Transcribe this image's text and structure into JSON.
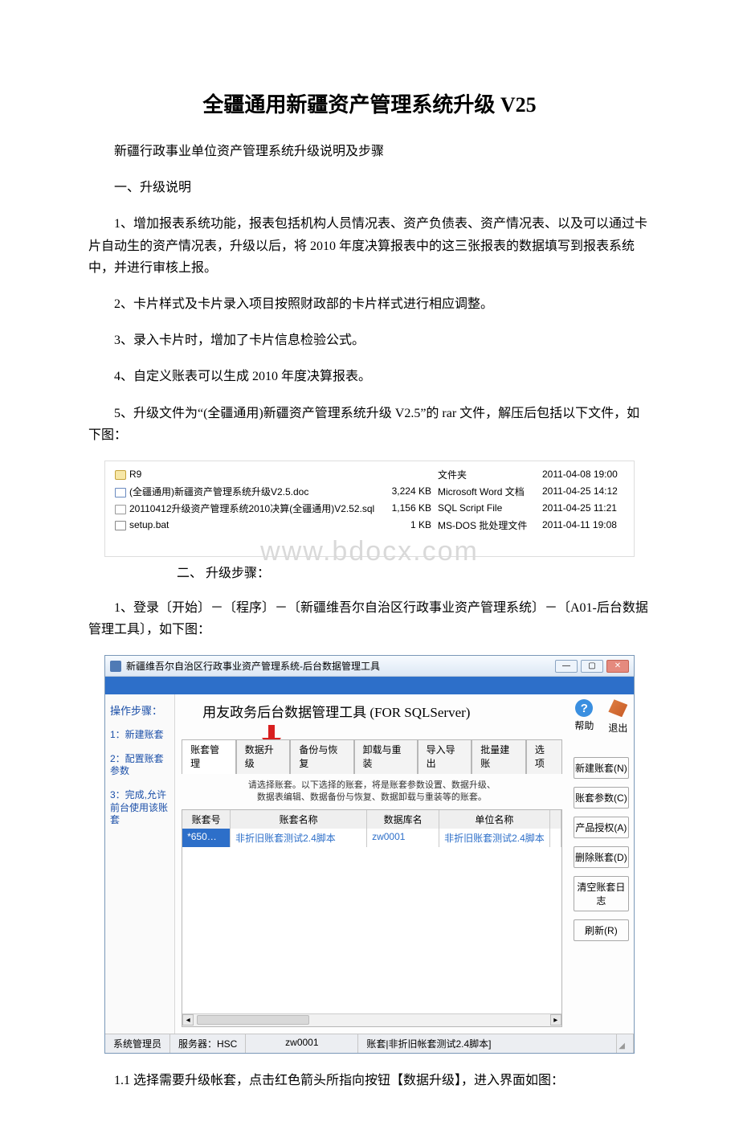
{
  "title": "全疆通用新疆资产管理系统升级 V25",
  "intro": "新疆行政事业单位资产管理系统升级说明及步骤",
  "sec1_header": "一、升级说明",
  "p1": "1、增加报表系统功能，报表包括机构人员情况表、资产负债表、资产情况表、以及可以通过卡片自动生的资产情况表，升级以后，将 2010 年度决算报表中的这三张报表的数据填写到报表系统中，并进行审核上报。",
  "p2": "2、卡片样式及卡片录入项目按照财政部的卡片样式进行相应调整。",
  "p3": "3、录入卡片时，增加了卡片信息检验公式。",
  "p4": "4、自定义账表可以生成 2010 年度决算报表。",
  "p5": "5、升级文件为“(全疆通用)新疆资产管理系统升级 V2.5”的 rar 文件，解压后包括以下文件，如下图：",
  "filelist": {
    "header": {
      "c1": "文件夹",
      "c2": ""
    },
    "rows": [
      {
        "icon": "folder",
        "name": "R9",
        "size": "",
        "type": "文件夹",
        "date": "2011-04-08 19:00"
      },
      {
        "icon": "doc",
        "name": "(全疆通用)新疆资产管理系统升级V2.5.doc",
        "size": "3,224 KB",
        "type": "Microsoft Word 文档",
        "date": "2011-04-25 14:12"
      },
      {
        "icon": "sql",
        "name": "20110412升级资产管理系统2010决算(全疆通用)V2.52.sql",
        "size": "1,156 KB",
        "type": "SQL Script File",
        "date": "2011-04-25 11:21"
      },
      {
        "icon": "bat",
        "name": "setup.bat",
        "size": "1 KB",
        "type": "MS-DOS 批处理文件",
        "date": "2011-04-11 19:08"
      }
    ]
  },
  "watermark": "www.bdocx.com",
  "sec2_header": "二、 升级步骤：",
  "p6": "1、登录〔开始〕－〔程序〕－〔新疆维吾尔自治区行政事业资产管理系统〕－〔A01-后台数据管理工具〕，如下图：",
  "appwin": {
    "title": "新疆维吾尔自治区行政事业资产管理系统-后台数据管理工具",
    "help_label": "帮助",
    "exit_label": "退出",
    "left": {
      "header": "操作步骤：",
      "s1": "1：新建账套",
      "s2": "2：配置账套参数",
      "s3": "3：完成,允许前台使用该账套"
    },
    "tooltitle": "用友政务后台数据管理工具 (FOR SQLServer)",
    "tabs": [
      "账套管理",
      "数据升级",
      "备份与恢复",
      "卸载与重装",
      "导入导出",
      "批量建账",
      "选项"
    ],
    "hint_l1": "请选择账套。以下选择的账套，将是账套参数设置、数据升级、",
    "hint_l2": "数据表编辑、数据备份与恢复、数据卸载与重装等的账套。",
    "grid": {
      "headers": [
        "账套号",
        "账套名称",
        "数据库名",
        "单位名称",
        ""
      ],
      "row": {
        "c0": "*650…",
        "c1": "非折旧账套测试2.4脚本",
        "c2": "zw0001",
        "c3": "非折旧账套测试2.4脚本",
        "c4": ""
      }
    },
    "buttons": [
      "新建账套(N)",
      "账套参数(C)",
      "产品授权(A)",
      "删除账套(D)",
      "清空账套日志",
      "刷新(R)"
    ],
    "status": {
      "s0": "系统管理员",
      "s1": "服务器：HSC",
      "s2": "zw0001",
      "s3": "账套|非折旧帐套测试2.4脚本]"
    }
  },
  "p7": "1.1 选择需要升级帐套，点击红色箭头所指向按钮【数据升级】，进入界面如图："
}
